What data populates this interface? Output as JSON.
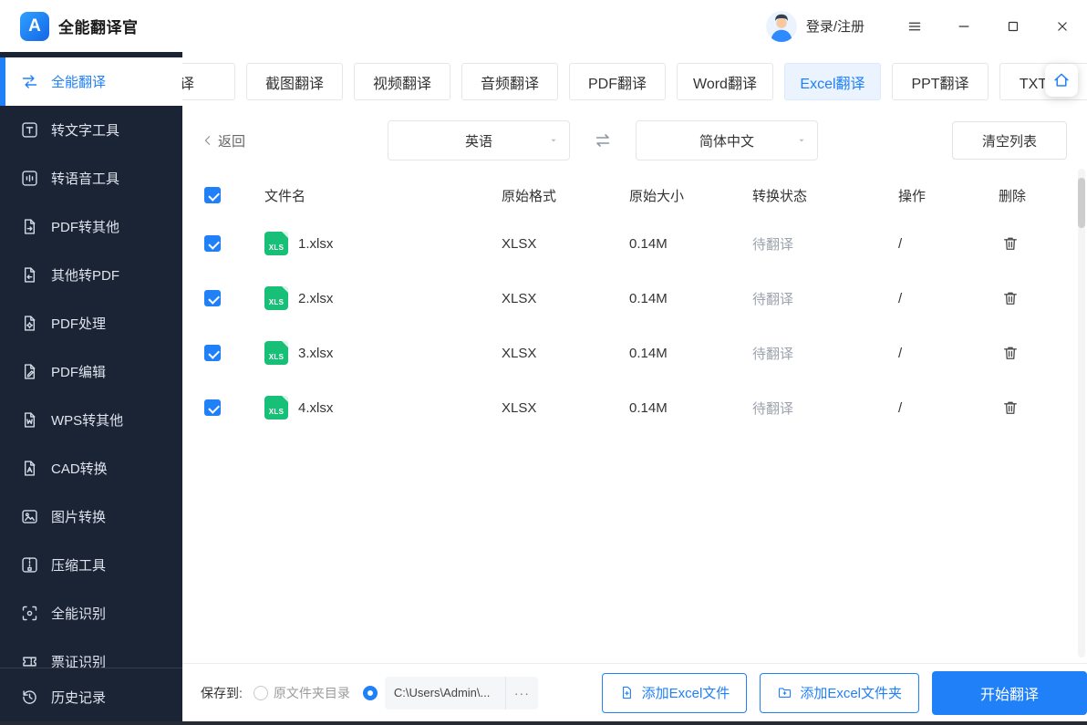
{
  "app": {
    "title": "全能翻译官",
    "logo_letter": "A"
  },
  "topbar": {
    "login_label": "登录/注册"
  },
  "sidebar": {
    "items": [
      {
        "label": "全能翻译",
        "icon": "translate-icon",
        "active": true
      },
      {
        "label": "转文字工具",
        "icon": "to-text-icon"
      },
      {
        "label": "转语音工具",
        "icon": "to-audio-icon"
      },
      {
        "label": "PDF转其他",
        "icon": "pdf-to-other-icon"
      },
      {
        "label": "其他转PDF",
        "icon": "other-to-pdf-icon"
      },
      {
        "label": "PDF处理",
        "icon": "pdf-process-icon"
      },
      {
        "label": "PDF编辑",
        "icon": "pdf-edit-icon"
      },
      {
        "label": "WPS转其他",
        "icon": "wps-convert-icon"
      },
      {
        "label": "CAD转换",
        "icon": "cad-convert-icon"
      },
      {
        "label": "图片转换",
        "icon": "image-convert-icon"
      },
      {
        "label": "压缩工具",
        "icon": "compress-icon"
      },
      {
        "label": "全能识别",
        "icon": "recognize-icon"
      },
      {
        "label": "票证识别",
        "icon": "ticket-icon"
      }
    ],
    "history": {
      "label": "历史记录",
      "icon": "history-icon"
    }
  },
  "tabs": [
    {
      "label": "译",
      "cut_left": true
    },
    {
      "label": "截图翻译"
    },
    {
      "label": "视频翻译"
    },
    {
      "label": "音频翻译"
    },
    {
      "label": "PDF翻译"
    },
    {
      "label": "Word翻译"
    },
    {
      "label": "Excel翻译",
      "active": true
    },
    {
      "label": "PPT翻译"
    },
    {
      "label": "TXT翻译",
      "cut_right": true
    }
  ],
  "toolbar": {
    "back_label": "返回",
    "source_language": "英语",
    "target_language": "简体中文",
    "clear_list_label": "清空列表"
  },
  "file_table": {
    "select_all_checked": true,
    "headers": {
      "name": "文件名",
      "format": "原始格式",
      "size": "原始大小",
      "status": "转换状态",
      "operation": "操作",
      "delete": "删除"
    },
    "rows": [
      {
        "name": "1.xlsx",
        "format": "XLSX",
        "size": "0.14M",
        "status": "待翻译",
        "operation": "/",
        "checked": true,
        "file_icon": "xls-file-icon"
      },
      {
        "name": "2.xlsx",
        "format": "XLSX",
        "size": "0.14M",
        "status": "待翻译",
        "operation": "/",
        "checked": true,
        "file_icon": "xls-file-icon"
      },
      {
        "name": "3.xlsx",
        "format": "XLSX",
        "size": "0.14M",
        "status": "待翻译",
        "operation": "/",
        "checked": true,
        "file_icon": "xls-file-icon"
      },
      {
        "name": "4.xlsx",
        "format": "XLSX",
        "size": "0.14M",
        "status": "待翻译",
        "operation": "/",
        "checked": true,
        "file_icon": "xls-file-icon"
      }
    ]
  },
  "footer": {
    "save_to_label": "保存到:",
    "original_folder_label": "原文件夹目录",
    "original_folder_selected": false,
    "custom_path_selected": true,
    "path_value": "C:\\Users\\Admin\\...",
    "browse_label": "···",
    "add_file_label": "添加Excel文件",
    "add_folder_label": "添加Excel文件夹",
    "start_label": "开始翻译"
  },
  "colors": {
    "accent": "#2080F7",
    "sidebar_bg": "#1B2434",
    "active_tab_bg": "#EAF3FE",
    "status_text": "#9CA3AC",
    "file_icon_green": "#17BF77"
  }
}
